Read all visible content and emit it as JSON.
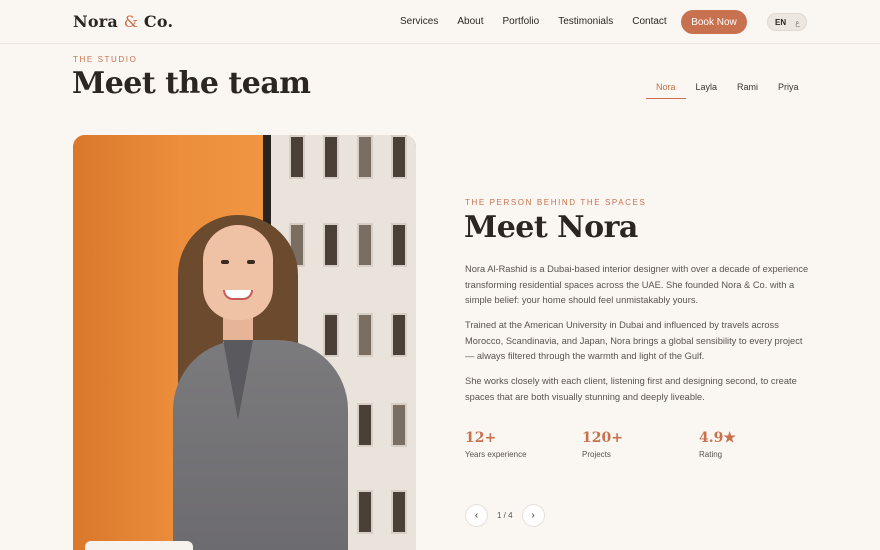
{
  "brand": {
    "name_part1": "Nora",
    "amp": "&",
    "name_part2": "Co."
  },
  "nav": {
    "items": [
      "Services",
      "About",
      "Portfolio",
      "Testimonials",
      "Contact"
    ],
    "cta": "Book Now",
    "lang_active": "EN",
    "lang_other": "ع"
  },
  "section": {
    "eyebrow": "THE STUDIO",
    "title": "Meet the team",
    "tabs": [
      "Nora",
      "Layla",
      "Rami",
      "Priya"
    ],
    "active_tab": "Nora"
  },
  "profile": {
    "eyebrow": "THE PERSON BEHIND THE SPACES",
    "title": "Meet Nora",
    "paragraphs": [
      "Nora Al-Rashid is a Dubai-based interior designer with over a decade of experience transforming residential spaces across the UAE. She founded Nora & Co. with a simple belief: your home should feel unmistakably yours.",
      "Trained at the American University in Dubai and influenced by travels across Morocco, Scandinavia, and Japan, Nora brings a global sensibility to every project — always filtered through the warmth and light of the Gulf.",
      "She works closely with each client, listening first and designing second, to create spaces that are both visually stunning and deeply liveable."
    ],
    "stats": [
      {
        "value": "12+",
        "label": "Years experience"
      },
      {
        "value": "120+",
        "label": "Projects"
      },
      {
        "value": "4.9★",
        "label": "Rating"
      }
    ],
    "pager": {
      "prev_icon": "‹",
      "count": "1 / 4",
      "next_icon": "›"
    }
  },
  "colors": {
    "accent": "#c8714e",
    "background": "#faf7f3",
    "text": "#2b2622"
  }
}
